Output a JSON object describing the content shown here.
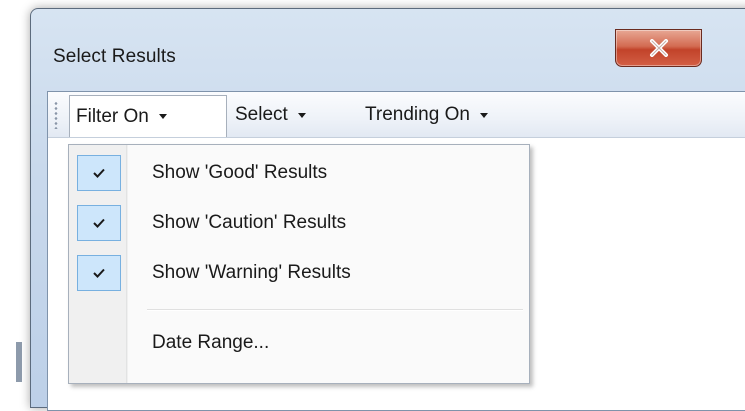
{
  "window": {
    "title": "Select Results"
  },
  "toolbar": {
    "items": [
      {
        "label": "Filter On"
      },
      {
        "label": "Select"
      },
      {
        "label": "Trending On"
      }
    ]
  },
  "filter_menu": {
    "items": [
      {
        "label": "Show 'Good' Results",
        "checked": true
      },
      {
        "label": "Show 'Caution' Results",
        "checked": true
      },
      {
        "label": "Show 'Warning' Results",
        "checked": true
      },
      {
        "label": "Date Range...",
        "checked": false
      }
    ]
  },
  "icons": {
    "close": "close-icon",
    "check": "check-icon",
    "dropdown_arrow": "chevron-down-icon",
    "grip": "grip-icon"
  },
  "colors": {
    "close_button": "#c2432a",
    "check_highlight": "#cde6fb",
    "check_border": "#77b0e0"
  }
}
